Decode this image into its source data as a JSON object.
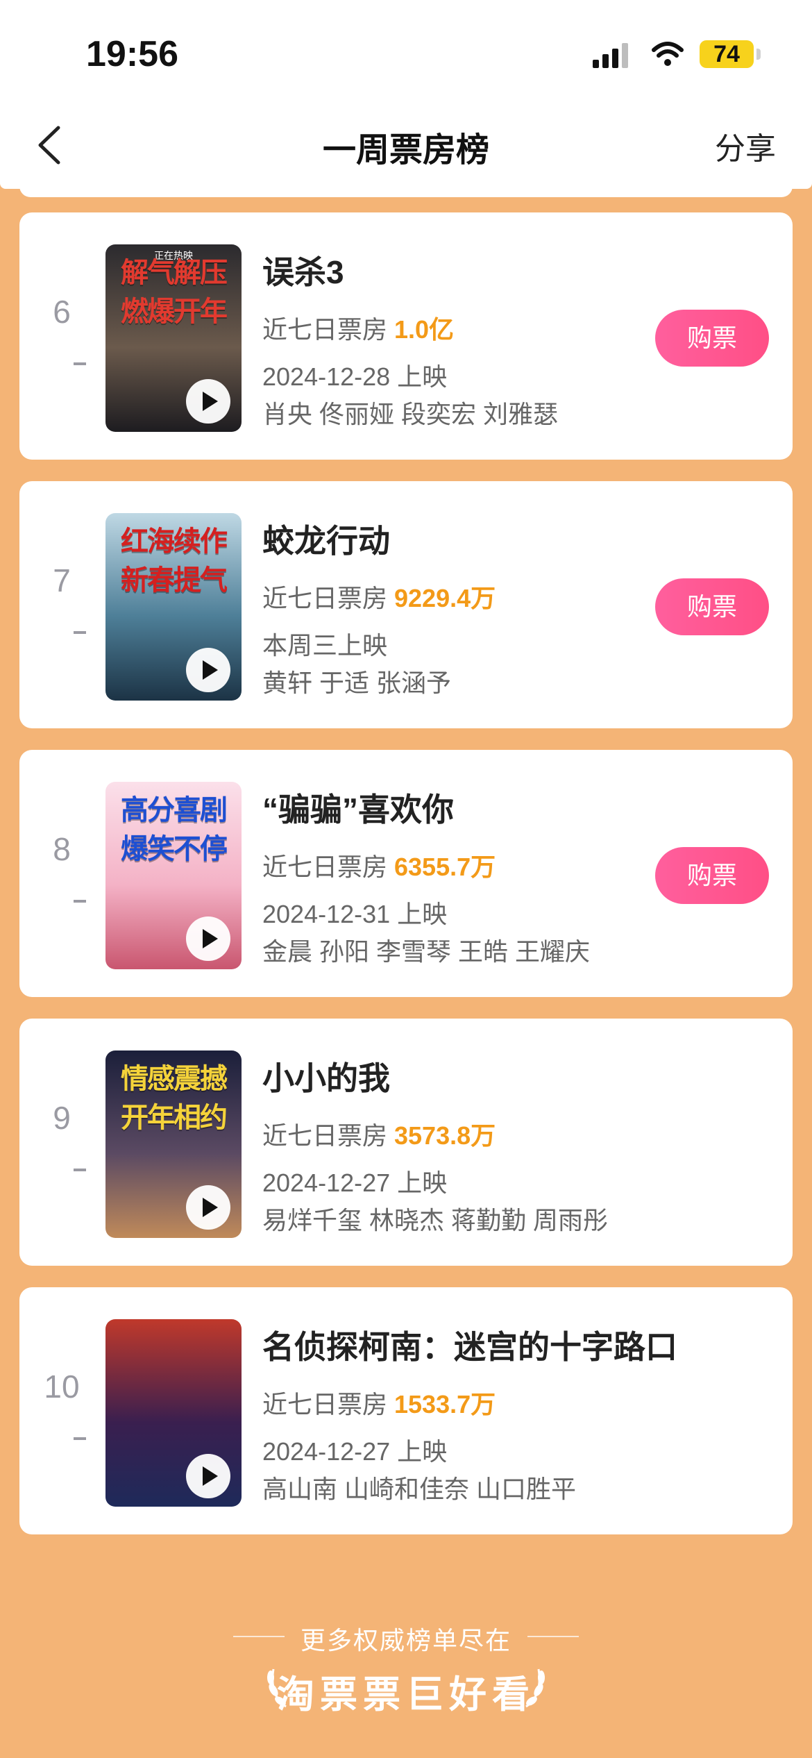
{
  "status_bar": {
    "time": "19:56",
    "battery": "74"
  },
  "header": {
    "title": "一周票房榜",
    "share_label": "分享"
  },
  "box_office_label": "近七日票房",
  "buy_label": "购票",
  "movies": [
    {
      "rank": "6",
      "title": "误杀3",
      "box_office": "1.0亿",
      "release": "2024-12-28 上映",
      "cast": "肖央 佟丽娅 段奕宏 刘雅瑟",
      "has_buy": true,
      "poster_headline": [
        "解气解压",
        "燃爆开年"
      ],
      "poster_tag": "正在热映",
      "poster_colors": [
        "#2b2a2e",
        "#6b5a4c",
        "#1d1c20"
      ],
      "headline_color": "#e23a2f"
    },
    {
      "rank": "7",
      "title": "蛟龙行动",
      "box_office": "9229.4万",
      "release": "本周三上映",
      "cast": "黄轩 于适 张涵予",
      "has_buy": true,
      "poster_headline": [
        "红海续作",
        "新春提气"
      ],
      "poster_tag": "",
      "poster_colors": [
        "#bfd8e4",
        "#4e7f98",
        "#1c3345"
      ],
      "headline_color": "#d42020"
    },
    {
      "rank": "8",
      "title": "“骗骗”喜欢你",
      "box_office": "6355.7万",
      "release": "2024-12-31 上映",
      "cast": "金晨 孙阳 李雪琴 王皓 王耀庆",
      "has_buy": true,
      "poster_headline": [
        "高分喜剧",
        "爆笑不停"
      ],
      "poster_tag": "",
      "poster_colors": [
        "#fbe0ea",
        "#f4b2c6",
        "#c9566f"
      ],
      "headline_color": "#1e4fd2"
    },
    {
      "rank": "9",
      "title": "小小的我",
      "box_office": "3573.8万",
      "release": "2024-12-27 上映",
      "cast": "易烊千玺 林晓杰 蒋勤勤 周雨彤",
      "has_buy": false,
      "poster_headline": [
        "情感震撼",
        "开年相约"
      ],
      "poster_tag": "",
      "poster_colors": [
        "#1b1f3a",
        "#5b4a63",
        "#c08a5a"
      ],
      "headline_color": "#f5d33a"
    },
    {
      "rank": "10",
      "title": "名侦探柯南：迷宫的十字路口",
      "box_office": "1533.7万",
      "release": "2024-12-27 上映",
      "cast": "高山南 山崎和佳奈 山口胜平",
      "has_buy": false,
      "poster_headline": [
        "",
        ""
      ],
      "poster_tag": "",
      "poster_colors": [
        "#c0392b",
        "#3a1f4f",
        "#1e2a5a"
      ],
      "headline_color": "#ffcc33"
    }
  ],
  "footer": {
    "text": "更多权威榜单尽在",
    "brand": "淘票票巨好看"
  },
  "colors": {
    "background": "#f4b476",
    "accent_orange": "#f39a18",
    "buy_pink": "#ff5a93",
    "rank_gray": "#9a9aa2"
  }
}
